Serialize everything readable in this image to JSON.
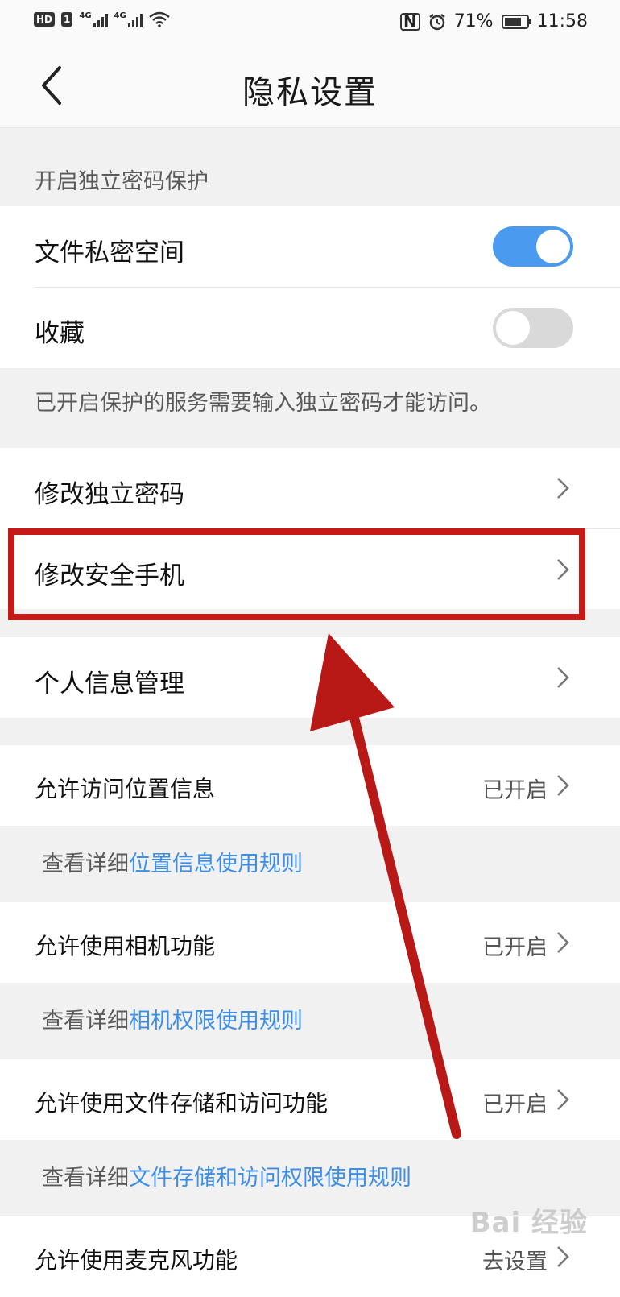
{
  "status_bar": {
    "hd": "HD",
    "sim1": "1",
    "net1": "4G",
    "net2": "4G",
    "battery_pct": "71%",
    "time": "11:58"
  },
  "header": {
    "title": "隐私设置",
    "back_icon": "chevron-left-icon"
  },
  "privacy": {
    "section_label": "开启独立密码保护",
    "items": [
      {
        "label": "文件私密空间",
        "toggle": true
      },
      {
        "label": "收藏",
        "toggle": false
      }
    ],
    "note": "已开启保护的服务需要输入独立密码才能访问。"
  },
  "nav_items": [
    {
      "label": "修改独立密码"
    },
    {
      "label": "修改安全手机"
    },
    {
      "label": "个人信息管理"
    }
  ],
  "permissions": [
    {
      "label": "允许访问位置信息",
      "value": "已开启",
      "note_prefix": "查看详细",
      "note_link": "位置信息使用规则"
    },
    {
      "label": "允许使用相机功能",
      "value": "已开启",
      "note_prefix": "查看详细",
      "note_link": "相机权限使用规则"
    },
    {
      "label": "允许使用文件存储和访问功能",
      "value": "已开启",
      "note_prefix": "查看详细",
      "note_link": "文件存储和访问权限使用规则"
    },
    {
      "label": "允许使用麦克风功能",
      "value": "去设置"
    }
  ],
  "annotation": {
    "color": "#c41a18"
  },
  "watermark": "Bai 经验",
  "colors": {
    "accent": "#4a9bf0",
    "link": "#3d8fe6",
    "background": "#f1f1f1"
  }
}
